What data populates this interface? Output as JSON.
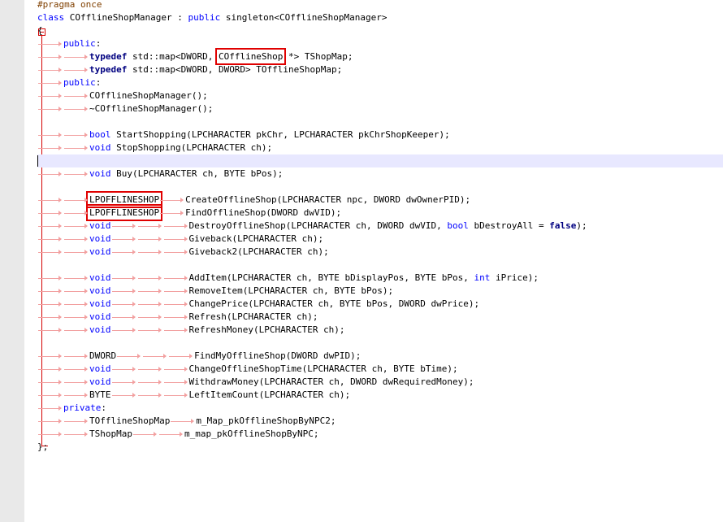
{
  "editor": {
    "lines": [
      [
        {
          "t": "#pragma once",
          "c": "pp"
        }
      ],
      [
        {
          "t": "class",
          "c": "kw"
        },
        {
          "t": " COfflineShopManager : "
        },
        {
          "t": "public",
          "c": "kw"
        },
        {
          "t": " singleton<COfflineShopManager>"
        }
      ],
      [
        {
          "t": "{"
        }
      ],
      [
        {
          "tab": 1
        },
        {
          "t": "public",
          "c": "kw"
        },
        {
          "t": ":"
        }
      ],
      [
        {
          "tab": 2
        },
        {
          "t": "typedef",
          "c": "type"
        },
        {
          "t": " std::map<DWORD, "
        },
        {
          "t": "COfflineShop",
          "h": 1
        },
        {
          "t": " *> TShopMap;"
        }
      ],
      [
        {
          "tab": 2
        },
        {
          "t": "typedef",
          "c": "type"
        },
        {
          "t": " std::map<DWORD, DWORD> TOfflineShopMap;"
        }
      ],
      [
        {
          "tab": 1
        },
        {
          "t": "public",
          "c": "kw"
        },
        {
          "t": ":"
        }
      ],
      [
        {
          "tab": 2
        },
        {
          "t": "COfflineShopManager();"
        }
      ],
      [
        {
          "tab": 2
        },
        {
          "t": "~COfflineShopManager();"
        }
      ],
      [],
      [
        {
          "tab": 2
        },
        {
          "t": "bool",
          "c": "kw"
        },
        {
          "t": " StartShopping(LPCHARACTER pkChr, LPCHARACTER pkChrShopKeeper);"
        }
      ],
      [
        {
          "tab": 2
        },
        {
          "t": "void",
          "c": "kw"
        },
        {
          "t": " StopShopping(LPCHARACTER ch);"
        }
      ],
      [
        {
          "current": 1
        }
      ],
      [
        {
          "tab": 2
        },
        {
          "t": "void",
          "c": "kw"
        },
        {
          "t": " Buy(LPCHARACTER ch, BYTE bPos);"
        }
      ],
      [],
      [
        {
          "tab": 2
        },
        {
          "t": "LPOFFLINESHOP",
          "h": 1
        },
        {
          "tab": 1
        },
        {
          "t": "CreateOfflineShop(LPCHARACTER npc, DWORD dwOwnerPID);"
        }
      ],
      [
        {
          "tab": 2
        },
        {
          "t": "LPOFFLINESHOP",
          "h": 1
        },
        {
          "tab": 1
        },
        {
          "t": "FindOfflineShop(DWORD dwVID);"
        }
      ],
      [
        {
          "tab": 2
        },
        {
          "t": "void",
          "c": "kw"
        },
        {
          "tab": 3
        },
        {
          "t": "DestroyOfflineShop(LPCHARACTER ch, DWORD dwVID, "
        },
        {
          "t": "bool",
          "c": "kw"
        },
        {
          "t": " bDestroyAll = "
        },
        {
          "t": "false",
          "c": "type"
        },
        {
          "t": ");"
        }
      ],
      [
        {
          "tab": 2
        },
        {
          "t": "void",
          "c": "kw"
        },
        {
          "tab": 3
        },
        {
          "t": "Giveback(LPCHARACTER ch);"
        }
      ],
      [
        {
          "tab": 2
        },
        {
          "t": "void",
          "c": "kw"
        },
        {
          "tab": 3
        },
        {
          "t": "Giveback2(LPCHARACTER ch);"
        }
      ],
      [],
      [
        {
          "tab": 2
        },
        {
          "t": "void",
          "c": "kw"
        },
        {
          "tab": 3
        },
        {
          "t": "AddItem(LPCHARACTER ch, BYTE bDisplayPos, BYTE bPos, "
        },
        {
          "t": "int",
          "c": "kw"
        },
        {
          "t": " iPrice);"
        }
      ],
      [
        {
          "tab": 2
        },
        {
          "t": "void",
          "c": "kw"
        },
        {
          "tab": 3
        },
        {
          "t": "RemoveItem(LPCHARACTER ch, BYTE bPos);"
        }
      ],
      [
        {
          "tab": 2
        },
        {
          "t": "void",
          "c": "kw"
        },
        {
          "tab": 3
        },
        {
          "t": "ChangePrice(LPCHARACTER ch, BYTE bPos, DWORD dwPrice);"
        }
      ],
      [
        {
          "tab": 2
        },
        {
          "t": "void",
          "c": "kw"
        },
        {
          "tab": 3
        },
        {
          "t": "Refresh(LPCHARACTER ch);"
        }
      ],
      [
        {
          "tab": 2
        },
        {
          "t": "void",
          "c": "kw"
        },
        {
          "tab": 3
        },
        {
          "t": "RefreshMoney(LPCHARACTER ch);"
        }
      ],
      [],
      [
        {
          "tab": 2
        },
        {
          "t": "DWORD"
        },
        {
          "tab": 3
        },
        {
          "t": "FindMyOfflineShop(DWORD dwPID);"
        }
      ],
      [
        {
          "tab": 2
        },
        {
          "t": "void",
          "c": "kw"
        },
        {
          "tab": 3
        },
        {
          "t": "ChangeOfflineShopTime(LPCHARACTER ch, BYTE bTime);"
        }
      ],
      [
        {
          "tab": 2
        },
        {
          "t": "void",
          "c": "kw"
        },
        {
          "tab": 3
        },
        {
          "t": "WithdrawMoney(LPCHARACTER ch, DWORD dwRequiredMoney);"
        }
      ],
      [
        {
          "tab": 2
        },
        {
          "t": "BYTE"
        },
        {
          "tab": 3
        },
        {
          "t": "LeftItemCount(LPCHARACTER ch);"
        }
      ],
      [
        {
          "tab": 1
        },
        {
          "t": "private",
          "c": "kw"
        },
        {
          "t": ":"
        }
      ],
      [
        {
          "tab": 2
        },
        {
          "t": "TOfflineShopMap"
        },
        {
          "tab": 1
        },
        {
          "t": "m_Map_pkOfflineShopByNPC2;"
        }
      ],
      [
        {
          "tab": 2
        },
        {
          "t": "TShopMap"
        },
        {
          "tab": 2
        },
        {
          "t": "m_map_pkOfflineShopByNPC;"
        }
      ],
      [
        {
          "t": "};"
        }
      ]
    ]
  }
}
